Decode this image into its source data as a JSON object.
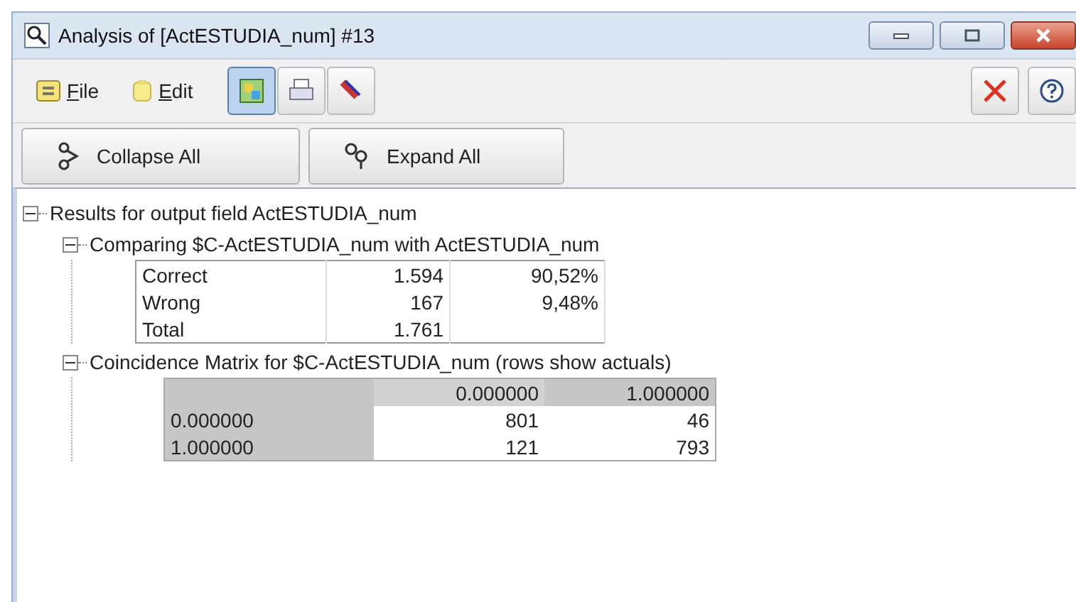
{
  "window": {
    "title": "Analysis of [ActESTUDIA_num] #13"
  },
  "menu": [
    {
      "label": "File"
    },
    {
      "label": "Edit"
    }
  ],
  "toolbar": [
    {
      "selected": true
    },
    {
      "selected": false
    },
    {
      "selected": false
    }
  ],
  "buttons": [
    {
      "label": "Collapse All",
      "kind": "collapse"
    },
    {
      "label": "Expand All",
      "kind": "expand"
    }
  ],
  "tree": {
    "label": "Results for output field ActESTUDIA_num",
    "expanded": true,
    "children": [
      {
        "label": "Comparing $C-ActESTUDIA_num with ActESTUDIA_num",
        "expanded": true,
        "kind": "summary",
        "rows": [
          [
            "Correct",
            "1.594",
            "90,52%"
          ],
          [
            "Wrong",
            "167",
            "9,48%"
          ],
          [
            "Total",
            "1.761",
            ""
          ]
        ]
      },
      {
        "label": "Coincidence Matrix for $C-ActESTUDIA_num (rows show actuals)",
        "expanded": true,
        "kind": "matrix",
        "columns": [
          "0.000000",
          "1.000000"
        ],
        "rows": [
          {
            "label": "0.000000",
            "values": [
              "801",
              "46"
            ]
          },
          {
            "label": "1.000000",
            "values": [
              "121",
              "793"
            ]
          }
        ]
      }
    ]
  }
}
